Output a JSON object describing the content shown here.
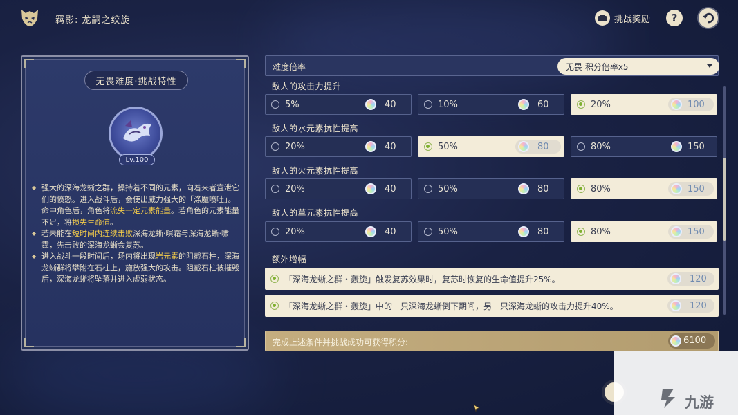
{
  "header": {
    "title": "羁影: 龙嗣之绞旋",
    "reward_label": "挑战奖励"
  },
  "left_panel": {
    "title": "无畏难度·挑战特性",
    "level": "Lv.100",
    "desc": [
      [
        "强大的深海龙蜥之群，操持着不同的元素，向着来者宣泄它们的愤怒。进入战斗后，会使出威力强大的「涤魔喷吐」。命中角色后，角色将",
        "流失一定元素能量",
        "。若角色的元素能量不足，将",
        "损失生命值",
        "。"
      ],
      [
        "若未能在",
        "短时间内连续击败",
        "深海龙蜥·暝霜与深海龙蜥·啸霆，先击败的深海龙蜥会复苏。",
        "",
        ""
      ],
      [
        "进入战斗一段时间后，场内将出现",
        "岩元素",
        "的阻截石柱，深海龙蜥群将攀附在石柱上，施放强大的攻击。阻截石柱被摧毁后，深海龙蜥将坠落并进入虚弱状态。",
        "",
        ""
      ]
    ]
  },
  "difficulty": {
    "label": "难度倍率",
    "selected": "无畏  积分倍率x5"
  },
  "categories": [
    {
      "label": "敌人的攻击力提升",
      "options": [
        {
          "text": "5%",
          "points": "40",
          "selected": false
        },
        {
          "text": "10%",
          "points": "60",
          "selected": false
        },
        {
          "text": "20%",
          "points": "100",
          "selected": true
        }
      ]
    },
    {
      "label": "敌人的水元素抗性提高",
      "options": [
        {
          "text": "20%",
          "points": "40",
          "selected": false
        },
        {
          "text": "50%",
          "points": "80",
          "selected": true
        },
        {
          "text": "80%",
          "points": "150",
          "selected": false
        }
      ]
    },
    {
      "label": "敌人的火元素抗性提高",
      "options": [
        {
          "text": "20%",
          "points": "40",
          "selected": false
        },
        {
          "text": "50%",
          "points": "80",
          "selected": false
        },
        {
          "text": "80%",
          "points": "150",
          "selected": true
        }
      ]
    },
    {
      "label": "敌人的草元素抗性提高",
      "options": [
        {
          "text": "20%",
          "points": "40",
          "selected": false
        },
        {
          "text": "50%",
          "points": "80",
          "selected": false
        },
        {
          "text": "80%",
          "points": "150",
          "selected": true
        }
      ]
    }
  ],
  "extra": {
    "label": "额外增幅",
    "items": [
      {
        "text": "「深海龙蜥之群・轰旋」触发复苏效果时，复苏时恢复的生命值提升25%。",
        "points": "120"
      },
      {
        "text": "「深海龙蜥之群・轰旋」中的一只深海龙蜥倒下期间，另一只深海龙蜥的攻击力提升40%。",
        "points": "120"
      }
    ]
  },
  "footer": {
    "label": "完成上述条件并挑战成功可获得积分:",
    "total": "6100"
  },
  "watermark": {
    "text": "九游"
  },
  "icons": [
    "mask-logo-icon",
    "reward-icon",
    "help-icon",
    "back-arrow-icon",
    "point-gem-icon",
    "dropdown-arrow-icon"
  ]
}
